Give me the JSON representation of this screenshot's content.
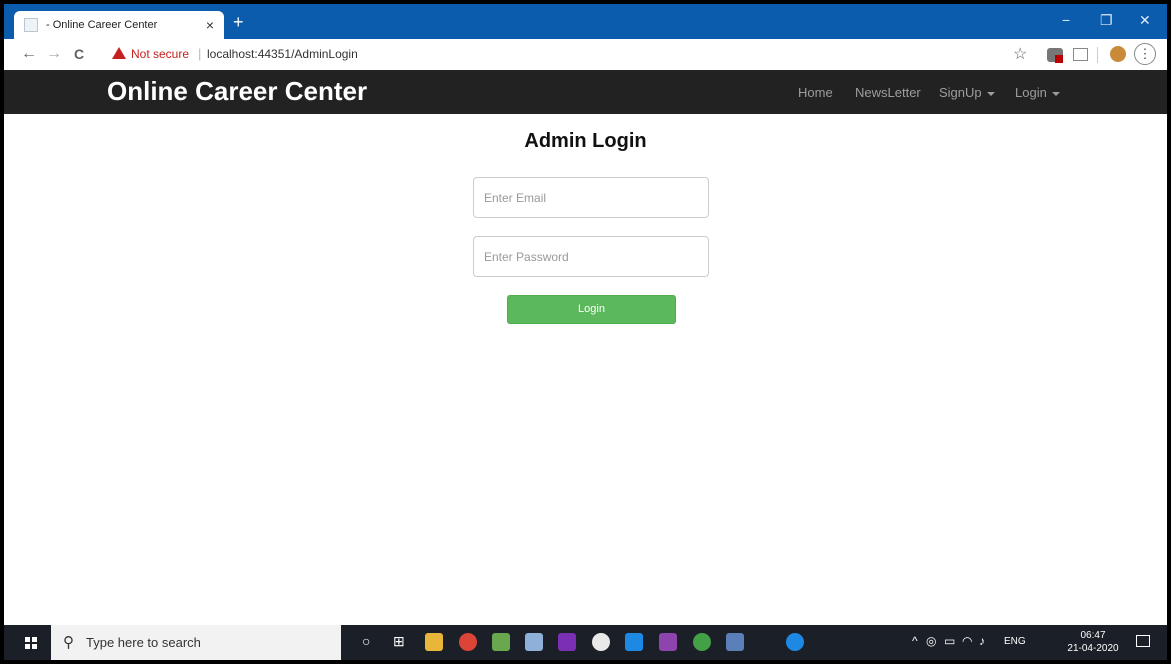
{
  "browser": {
    "tab_title": "- Online Career Center",
    "tab_close": "×",
    "new_tab": "+",
    "window_controls": {
      "minimize": "−",
      "maximize": "❐",
      "close": "✕"
    },
    "back": "←",
    "forward": "→",
    "reload": "C",
    "security_text": "Not secure",
    "url": "localhost:44351/AdminLogin",
    "bookmark_icon": "☆",
    "menu_icon": "⋮"
  },
  "site": {
    "brand": "Online Career Center",
    "nav": {
      "home": "Home",
      "newsletter": "NewsLetter",
      "signup": "SignUp",
      "login": "Login"
    }
  },
  "form": {
    "heading": "Admin Login",
    "email_placeholder": "Enter Email",
    "password_placeholder": "Enter Password",
    "submit_label": "Login"
  },
  "taskbar": {
    "search_placeholder": "Type here to search",
    "search_icon": "⚲",
    "language": "ENG",
    "time": "06:47",
    "date": "21-04-2020"
  },
  "colors": {
    "titlebar": "#0b5cad",
    "navbar": "#222222",
    "login_button": "#5cb85c",
    "warning": "#c5221f"
  }
}
